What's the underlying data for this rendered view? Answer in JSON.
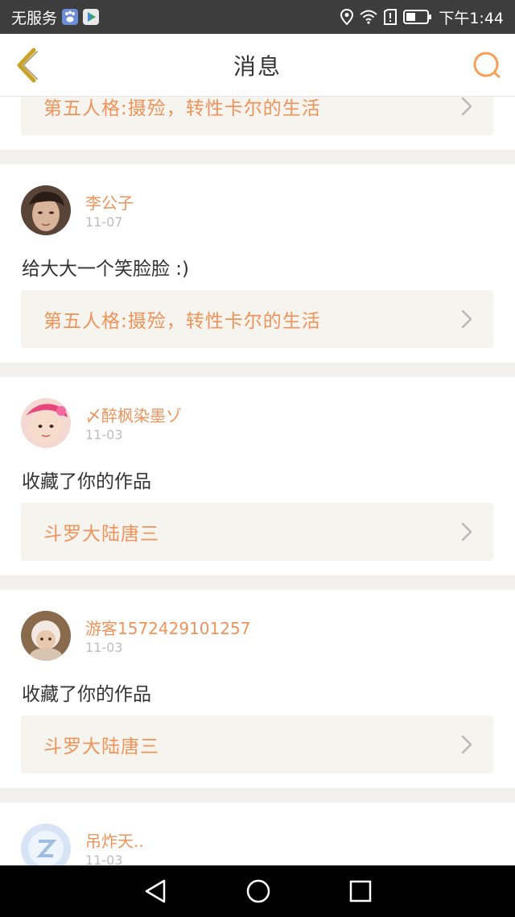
{
  "status_bar": {
    "carrier": "无服务",
    "time": "下午1:44",
    "icons": [
      "baidu-paw-icon",
      "play-store-icon",
      "location-icon",
      "wifi-icon",
      "sim-alert-icon",
      "battery-icon"
    ]
  },
  "header": {
    "title": "消息",
    "back_icon": "back-chevron-icon",
    "search_icon": "search-icon"
  },
  "colors": {
    "accent": "#f0935a",
    "back": "#c9a227",
    "search": "#f5a05a"
  },
  "messages": [
    {
      "work_title": "第五人格:摄殓，转性卡尔的生活"
    },
    {
      "username": "李公子",
      "date": "11-07",
      "text": "给大大一个笑脸脸 :)",
      "work_title": "第五人格:摄殓，转性卡尔的生活"
    },
    {
      "username": "〆醉枫染墨ゾ",
      "date": "11-03",
      "text": "收藏了你的作品",
      "work_title": "斗罗大陆唐三"
    },
    {
      "username": "游客1572429101257",
      "date": "11-03",
      "text": "收藏了你的作品",
      "work_title": "斗罗大陆唐三"
    },
    {
      "username": "吊炸天..",
      "date": "11-03"
    }
  ],
  "nav_bar": {
    "icons": [
      "back-triangle-icon",
      "home-circle-icon",
      "recents-square-icon"
    ]
  }
}
